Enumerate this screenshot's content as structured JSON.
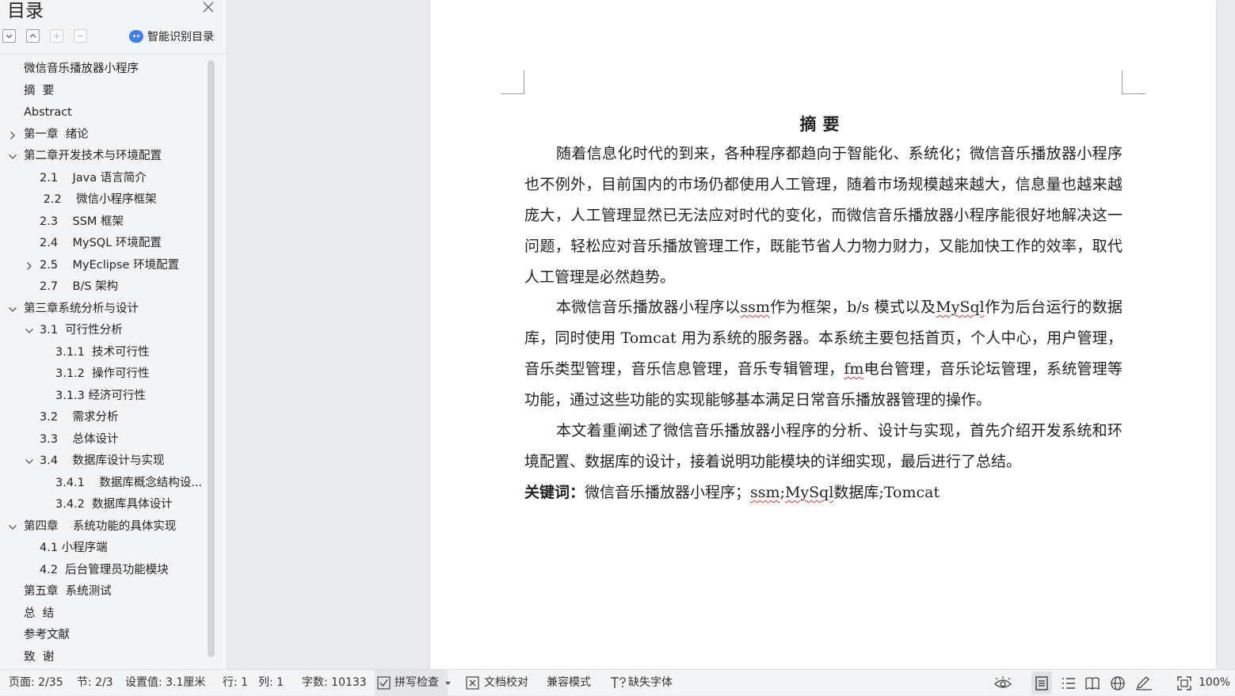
{
  "sidebar": {
    "title": "目录",
    "close_icon": "close-icon",
    "tools": [
      {
        "name": "collapse-all-icon",
        "enabled": true
      },
      {
        "name": "expand-all-icon",
        "enabled": true
      },
      {
        "name": "add-heading-icon",
        "enabled": false
      },
      {
        "name": "remove-heading-icon",
        "enabled": false
      }
    ],
    "smart_toc_label": "智能识别目录",
    "toc": [
      {
        "label": "微信音乐播放器小程序",
        "level": 0,
        "chevron": "none"
      },
      {
        "label": "摘  要",
        "level": 0,
        "chevron": "none"
      },
      {
        "label": "Abstract",
        "level": 0,
        "chevron": "none"
      },
      {
        "label": "第一章  绪论",
        "level": 0,
        "chevron": "right"
      },
      {
        "label": "第二章开发技术与环境配置",
        "level": 0,
        "chevron": "down"
      },
      {
        "label": "2.1    Java 语言简介",
        "level": 1,
        "chevron": "none"
      },
      {
        "label": " 2.2    微信小程序框架",
        "level": 1,
        "chevron": "none"
      },
      {
        "label": "2.3    SSM 框架",
        "level": 1,
        "chevron": "none"
      },
      {
        "label": "2.4    MySQL 环境配置",
        "level": 1,
        "chevron": "none"
      },
      {
        "label": "2.5    MyEclipse 环境配置",
        "level": 1,
        "chevron": "right"
      },
      {
        "label": "2.7    B/S 架构",
        "level": 1,
        "chevron": "none"
      },
      {
        "label": "第三章系统分析与设计",
        "level": 0,
        "chevron": "down"
      },
      {
        "label": "3.1  可行性分析",
        "level": 1,
        "chevron": "down"
      },
      {
        "label": "3.1.1  技术可行性",
        "level": 2,
        "chevron": "none"
      },
      {
        "label": "3.1.2  操作可行性",
        "level": 2,
        "chevron": "none"
      },
      {
        "label": "3.1.3 经济可行性",
        "level": 2,
        "chevron": "none"
      },
      {
        "label": "3.2    需求分析",
        "level": 1,
        "chevron": "none"
      },
      {
        "label": "3.3    总体设计",
        "level": 1,
        "chevron": "none"
      },
      {
        "label": "3.4    数据库设计与实现",
        "level": 1,
        "chevron": "down"
      },
      {
        "label": "3.4.1    数据库概念结构设...",
        "level": 2,
        "chevron": "none"
      },
      {
        "label": "3.4.2  数据库具体设计",
        "level": 2,
        "chevron": "none"
      },
      {
        "label": "第四章    系统功能的具体实现",
        "level": 0,
        "chevron": "down"
      },
      {
        "label": "4.1 小程序端",
        "level": 1,
        "chevron": "none"
      },
      {
        "label": "4.2  后台管理员功能模块",
        "level": 1,
        "chevron": "none"
      },
      {
        "label": "第五章  系统测试",
        "level": 0,
        "chevron": "none"
      },
      {
        "label": "总  结",
        "level": 0,
        "chevron": "none"
      },
      {
        "label": "参考文献",
        "level": 0,
        "chevron": "none"
      },
      {
        "label": "致  谢",
        "level": 0,
        "chevron": "none"
      }
    ]
  },
  "document": {
    "heading": "摘要",
    "p1": "随着信息化时代的到来，各种程序都趋向于智能化、系统化；微信音乐播放器小程序也不例外，目前国内的市场仍都使用人工管理，随着市场规模越来越大，信息量也越来越庞大，人工管理显然已无法应对时代的变化，而微信音乐播放器小程序能很好地解决这一问题，轻松应对音乐播放管理工作，既能节省人力物力财力，又能加快工作的效率，取代人工管理是必然趋势。",
    "p2": {
      "a": "本微信音乐播放器小程序以",
      "ssm": "ssm",
      "b": "作为框架，b/s 模式以及",
      "mysql": "MySql",
      "c": "作为后台运行的数据库，同时使用 Tomcat 用为系统的服务器。本系统主要包括首页，个人中心，用户管理，音乐类型管理，音乐信息管理，音乐专辑管理，",
      "fm": "fm",
      "d": "电台管理，音乐论坛管理，系统管理等功能，通过这些功能的实现能够基本满足日常音乐播放器管理的操作。"
    },
    "p3": "本文着重阐述了微信音乐播放器小程序的分析、设计与实现，首先介绍开发系统和环境配置、数据库的设计，接着说明功能模块的详细实现，最后进行了总结。",
    "keywords": {
      "label": "关键词：",
      "a": "微信音乐播放器小程序；",
      "ssm": "ssm",
      "sep": ";",
      "mysql": "MySql",
      "b": "数据库;Tomcat"
    }
  },
  "status": {
    "page": "页面: 2/35",
    "section": "节: 2/3",
    "setting": "设置值: 3.1厘米",
    "row": "行: 1",
    "col": "列: 1",
    "words": "字数: 10133",
    "spell": "拼写检查",
    "proof": "文档校对",
    "compat": "兼容模式",
    "missing_font": "缺失字体",
    "zoom": "100%"
  },
  "colors": {
    "accent": "#3d7ef6",
    "spell_error": "#dd3333"
  }
}
